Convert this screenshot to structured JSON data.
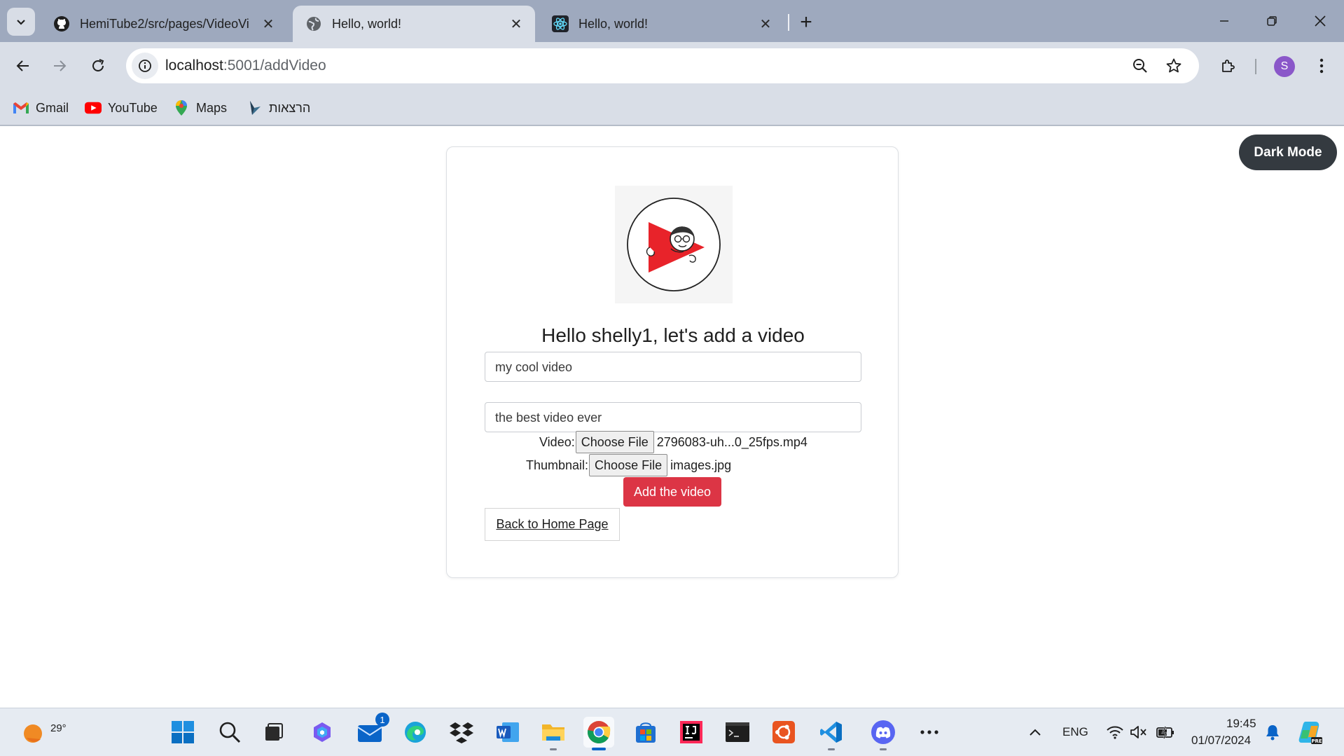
{
  "browser": {
    "tabs": [
      {
        "title": "HemiTube2/src/pages/VideoVi",
        "icon": "github-icon",
        "active": false
      },
      {
        "title": "Hello, world!",
        "icon": "globe-icon",
        "active": true
      },
      {
        "title": "Hello, world!",
        "icon": "react-icon",
        "active": false
      }
    ],
    "url_host": "localhost",
    "url_path": ":5001/addVideo",
    "bookmarks": [
      {
        "label": "Gmail",
        "icon": "gmail-icon"
      },
      {
        "label": "YouTube",
        "icon": "youtube-icon"
      },
      {
        "label": "Maps",
        "icon": "maps-icon"
      },
      {
        "label": "הרצאות",
        "icon": "bookmark-app-icon"
      }
    ],
    "profile_initial": "S"
  },
  "page": {
    "dark_mode_label": "Dark Mode",
    "heading": "Hello shelly1, let's add a video",
    "title_value": "my cool video",
    "description_value": "the best video ever",
    "video_label": "Video:",
    "video_file": "2796083-uh...0_25fps.mp4",
    "thumbnail_label": "Thumbnail:",
    "thumbnail_file": "images.jpg",
    "choose_file_label": "Choose File",
    "add_button": "Add the video",
    "back_link": "Back to Home Page"
  },
  "taskbar": {
    "weather_temp": "29°",
    "mail_badge": "1",
    "language": "ENG",
    "time": "19:45",
    "date": "01/07/2024"
  },
  "colors": {
    "add_button": "#dc3545",
    "dark_mode_button": "#343a40",
    "tabstrip": "#9ea9be",
    "toolbar": "#d9dee7"
  }
}
